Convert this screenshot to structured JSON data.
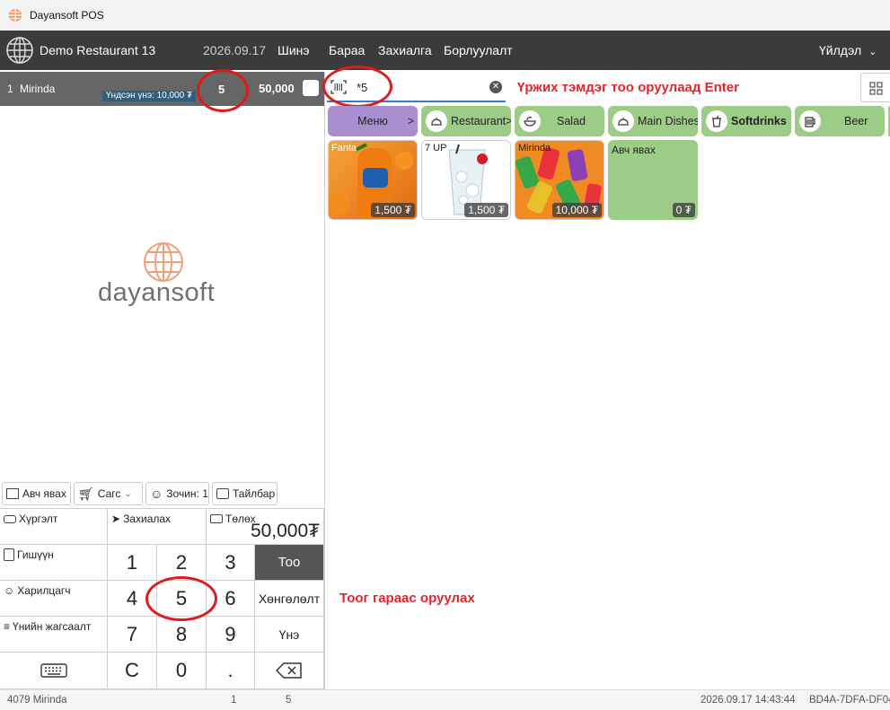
{
  "window": {
    "title": "Dayansoft POS"
  },
  "menubar": {
    "restaurant": "Demo Restaurant 13",
    "date": "2026.09.17",
    "items": [
      "Шинэ",
      "Бараа",
      "Захиалга",
      "Борлуулалт"
    ],
    "user_menu": "Үйлдэл"
  },
  "order": {
    "line_no": "1",
    "item_name": "Mirinda",
    "base_price_label": "Үндсэн үнэ: 10,000 ₮",
    "qty": "5",
    "amount": "50,000"
  },
  "brand": {
    "logo_text": "dayansoft"
  },
  "search": {
    "value": "*5"
  },
  "annotations": {
    "barcode_hint": "Үржих тэмдэг тоо оруулаад Enter",
    "keypad_hint": "Тоог гараас оруулах"
  },
  "categories": [
    {
      "label": "Меню",
      "suffix": ">",
      "icon": "none"
    },
    {
      "label": "Restaurant",
      "suffix": ">",
      "icon": "cloche-icon"
    },
    {
      "label": "Salad",
      "suffix": "",
      "icon": "salad-bowl-icon"
    },
    {
      "label": "Main Dishes",
      "suffix": "",
      "icon": "cloche-icon"
    },
    {
      "label": "Softdrinks",
      "suffix": "",
      "icon": "cup-icon"
    },
    {
      "label": "Beer",
      "suffix": "",
      "icon": "beer-mug-icon"
    }
  ],
  "products": [
    {
      "name": "Fanta",
      "price": "1,500 ₮"
    },
    {
      "name": "7 UP",
      "price": "1,500 ₮"
    },
    {
      "name": "Mirinda",
      "price": "10,000 ₮"
    },
    {
      "name": "Авч явах",
      "price": "0 ₮"
    }
  ],
  "actions": {
    "takeaway": "Авч явах",
    "cart": "Сагс",
    "guests": "Зочин: 1",
    "comment": "Тайлбар"
  },
  "pad": {
    "delivery": "Хүргэлт",
    "send_order": "Захиалах",
    "payment": "Төлөх",
    "total": "50,000₮",
    "member": "Гишүүн",
    "customer": "Харилцагч",
    "price_list": "Үнийн жагсаалт",
    "qty": "Тоо",
    "discount": "Хөнгөлөлт",
    "price": "Үнэ",
    "k1": "1",
    "k2": "2",
    "k3": "3",
    "k4": "4",
    "k5": "5",
    "k6": "6",
    "k7": "7",
    "k8": "8",
    "k9": "9",
    "kc": "C",
    "k0": "0",
    "kdot": "."
  },
  "status": {
    "item": "4079 Mirinda",
    "lines": "1",
    "qty": "5",
    "datetime": "2026.09.17 14:43:44",
    "code": "BD4A-7DFA-DF04"
  },
  "colors": {
    "accent_red": "#e0191c",
    "category_green": "#9ccc85",
    "category_purple": "#a98fd0",
    "menubar": "#3b3b3b"
  }
}
